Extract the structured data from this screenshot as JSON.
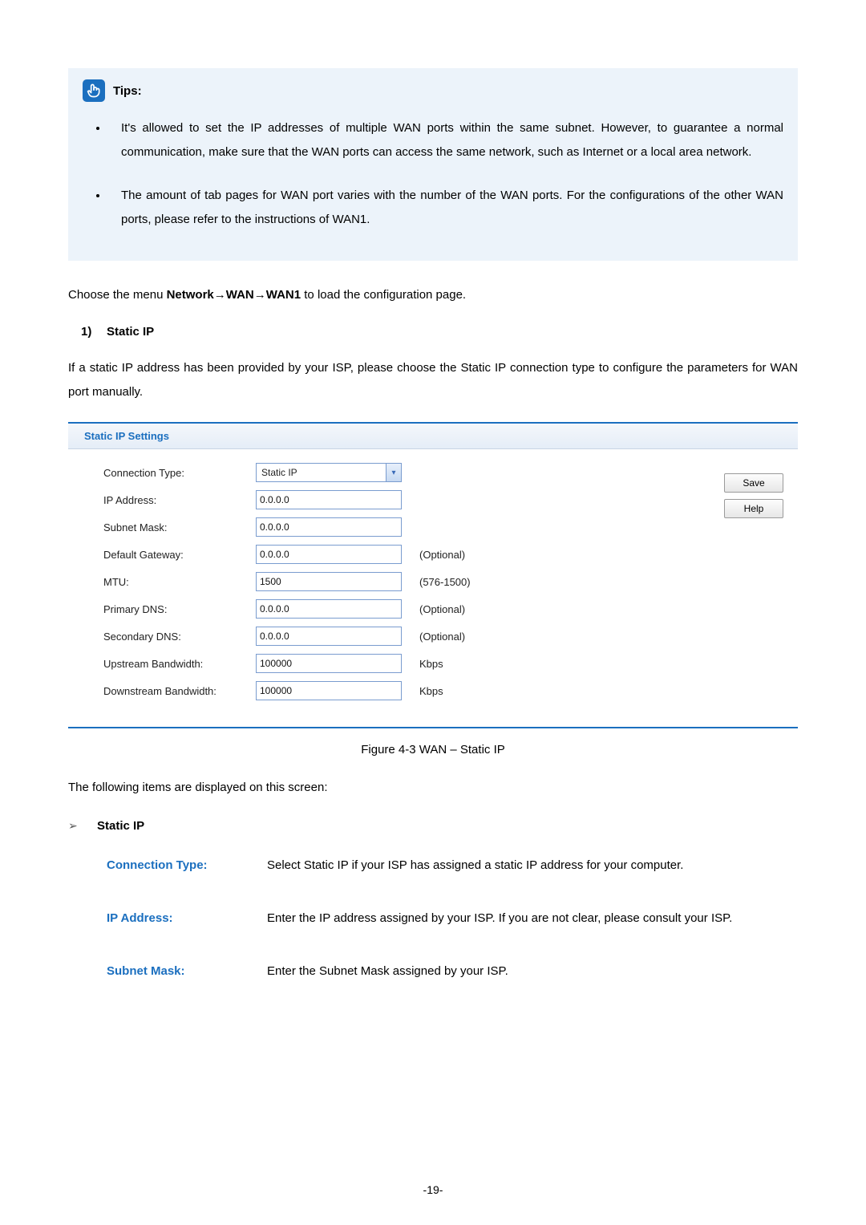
{
  "tipsBox": {
    "title": "Tips:",
    "items": [
      "It's allowed to set the IP addresses of multiple WAN ports within the same subnet. However, to guarantee a normal communication, make sure that the WAN ports can access the same network, such as Internet or a local area network.",
      "The amount of tab pages for WAN port varies with the number of the WAN ports. For the configurations of the other WAN ports, please refer to the instructions of WAN1."
    ]
  },
  "menuPath": {
    "pre": "Choose the menu ",
    "path": "Network→WAN→WAN1",
    "post": " to load the configuration page."
  },
  "section1": {
    "num": "1)",
    "title": "Static IP",
    "intro": "If a static IP address has been provided by your ISP, please choose the Static IP connection type to configure the parameters for WAN port manually."
  },
  "panel": {
    "title": "Static IP Settings",
    "labels": {
      "connType": "Connection Type:",
      "ip": "IP Address:",
      "mask": "Subnet Mask:",
      "gw": "Default Gateway:",
      "mtu": "MTU:",
      "pdns": "Primary DNS:",
      "sdns": "Secondary DNS:",
      "up": "Upstream Bandwidth:",
      "down": "Downstream Bandwidth:"
    },
    "values": {
      "connType": "Static IP",
      "ip": "0.0.0.0",
      "mask": "0.0.0.0",
      "gw": "0.0.0.0",
      "mtu": "1500",
      "pdns": "0.0.0.0",
      "sdns": "0.0.0.0",
      "up": "100000",
      "down": "100000"
    },
    "suffix": {
      "optional": "(Optional)",
      "mtuRange": "(576-1500)",
      "kbps": "Kbps"
    },
    "buttons": {
      "save": "Save",
      "help": "Help"
    }
  },
  "figCaption": "Figure 4-3 WAN – Static IP",
  "followText": "The following items are displayed on this screen:",
  "subHead": "Static IP",
  "defs": {
    "connType": {
      "term": "Connection Type:",
      "desc": "Select Static IP if your ISP has assigned a static IP address for your computer."
    },
    "ip": {
      "term": "IP Address:",
      "desc": "Enter the IP address assigned by your ISP. If you are not clear, please consult your ISP."
    },
    "mask": {
      "term": "Subnet Mask:",
      "desc": "Enter the Subnet Mask assigned by your ISP."
    }
  },
  "pageNumber": "-19-"
}
